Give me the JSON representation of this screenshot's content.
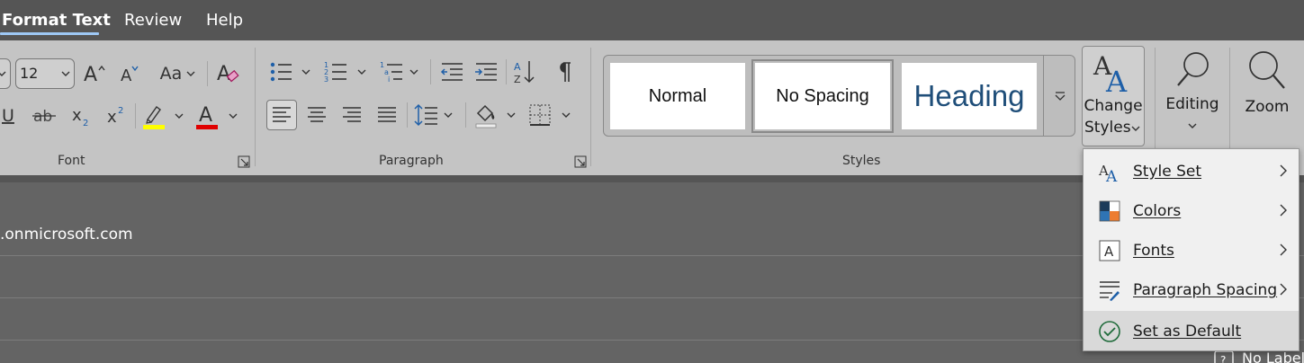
{
  "tabs": [
    {
      "label": "Format Text",
      "active": true
    },
    {
      "label": "Review",
      "active": false
    },
    {
      "label": "Help",
      "active": false
    }
  ],
  "font_group": {
    "font_size": "12",
    "case_label": "Aa",
    "label": "Font"
  },
  "paragraph_group": {
    "label": "Paragraph"
  },
  "styles_group": {
    "label": "Styles",
    "tiles": [
      {
        "label": "Normal",
        "selected": false
      },
      {
        "label": "No Spacing",
        "selected": true
      },
      {
        "label": "Heading",
        "selected": false
      }
    ],
    "change_styles": {
      "line1": "Change",
      "line2": "Styles"
    }
  },
  "editing": {
    "label": "Editing"
  },
  "zoom": {
    "label": "Zoom"
  },
  "colors": {
    "accent_blue": "#1e5fa8",
    "heading_blue": "#1f4e79",
    "highlight_yellow": "#ffff00",
    "font_red": "#e00000",
    "tab_underline": "#9ec8f5",
    "check_green": "#1f6b3a"
  },
  "document": {
    "email_fragment": ".onmicrosoft.com",
    "sensitivity_label": "No Label"
  },
  "change_styles_menu": {
    "items": [
      {
        "label": "Style Set",
        "icon": "style-set-icon",
        "submenu": true
      },
      {
        "label": "Colors",
        "icon": "colors-icon",
        "submenu": true
      },
      {
        "label": "Fonts",
        "icon": "fonts-icon",
        "submenu": true
      },
      {
        "label": "Paragraph Spacing",
        "icon": "paragraph-spacing-icon",
        "submenu": true
      },
      {
        "label": "Set as Default",
        "icon": "checkmark-circle-icon",
        "submenu": false,
        "highlighted": true
      }
    ]
  }
}
